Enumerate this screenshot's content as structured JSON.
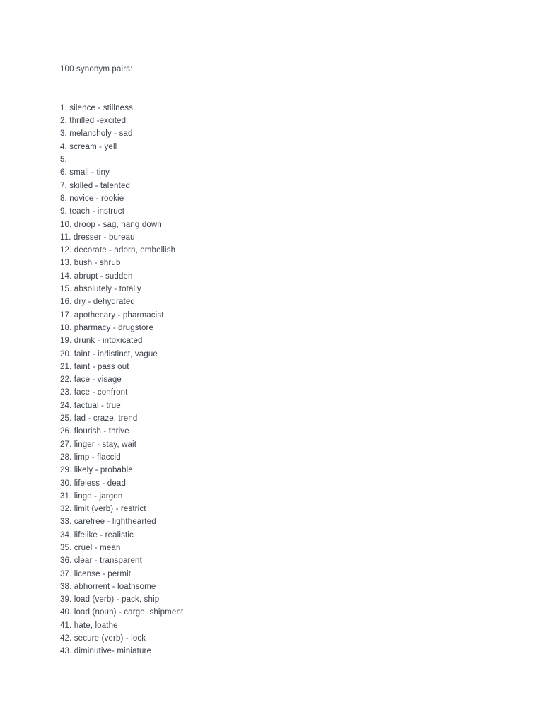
{
  "document": {
    "title": "100 synonym pairs:",
    "text_color": "#3b414c",
    "background_color": "#ffffff",
    "entries": [
      "1. silence - stillness",
      "2. thrilled -excited",
      "3. melancholy - sad",
      "4. scream - yell",
      "5.",
      "6. small - tiny",
      "7. skilled - talented",
      "8. novice - rookie",
      "9. teach - instruct",
      "10. droop - sag, hang down",
      "11. dresser - bureau",
      "12. decorate - adorn, embellish",
      "13. bush - shrub",
      "14. abrupt - sudden",
      "15. absolutely - totally",
      "16. dry - dehydrated",
      "17. apothecary - pharmacist",
      "18. pharmacy - drugstore",
      "19. drunk - intoxicated",
      "20. faint - indistinct, vague",
      "21. faint - pass out",
      "22. face - visage",
      "23. face - confront",
      "24. factual - true",
      "25. fad - craze, trend",
      "26. flourish - thrive",
      "27. linger - stay, wait",
      "28. limp - flaccid",
      "29. likely - probable",
      "30. lifeless - dead",
      "31. lingo - jargon",
      "32. limit (verb) - restrict",
      "33. carefree - lighthearted",
      "34. lifelike - realistic",
      "35. cruel - mean",
      "36. clear - transparent",
      "37. license - permit",
      "38. abhorrent - loathsome",
      "39. load (verb) - pack, ship",
      "40. load (noun) - cargo, shipment",
      "41. hate, loathe",
      "42. secure (verb) - lock",
      "43. diminutive- miniature"
    ]
  }
}
